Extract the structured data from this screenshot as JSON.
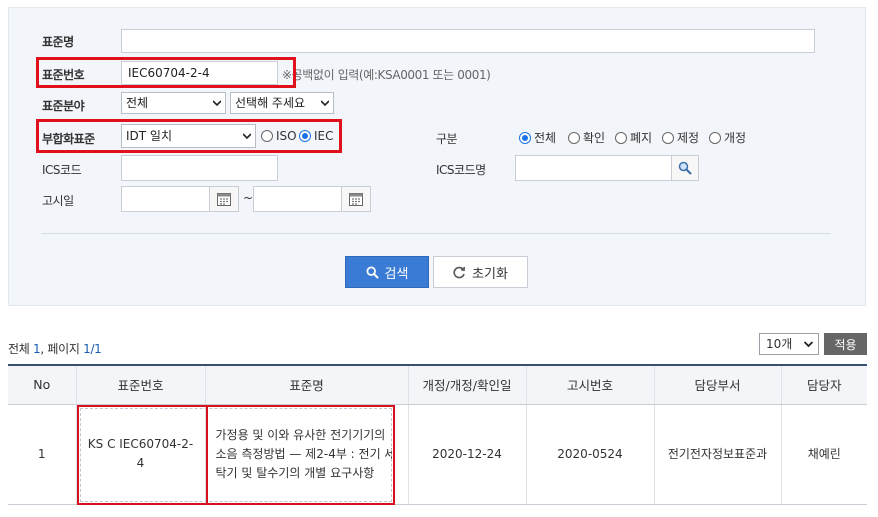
{
  "search": {
    "labels": {
      "name": "표준명",
      "number": "표준번호",
      "field": "표준분야",
      "conform": "부합화표준",
      "ics_code": "ICS코드",
      "notice_date": "고시일",
      "division": "구분",
      "ics_name": "ICS코드명"
    },
    "number_value": "IEC60704-2-4",
    "number_hint": "※공백없이 입력(예:KSA0001 또는 0001)",
    "field_select": "전체",
    "field_sub_select": "선택해 주세요",
    "conform_select": "IDT 일치",
    "conform_radios": [
      {
        "label": "ISO",
        "checked": false
      },
      {
        "label": "IEC",
        "checked": true
      }
    ],
    "division_radios": [
      {
        "label": "전체",
        "checked": true
      },
      {
        "label": "확인",
        "checked": false
      },
      {
        "label": "폐지",
        "checked": false
      },
      {
        "label": "제정",
        "checked": false
      },
      {
        "label": "개정",
        "checked": false
      }
    ],
    "date_sep": "~",
    "search_button": "검색",
    "reset_button": "초기화"
  },
  "results": {
    "total_label": "전체",
    "total_count": "1",
    "page_label": ", 페이지",
    "page_value": "1/1",
    "page_size": "10개",
    "apply_button": "적용",
    "columns": [
      "No",
      "표준번호",
      "표준명",
      "개정/개정/확인일",
      "고시번호",
      "담당부서",
      "담당자"
    ],
    "rows": [
      {
        "no": "1",
        "number": "KS C IEC60704-2-4",
        "title": "가정용 및 이와 유사한 전기기기의 소음 측정방법 — 제2-4부 : 전기 세탁기 및 탈수기의 개별 요구사항",
        "date": "2020-12-24",
        "notice": "2020-0524",
        "dept": "전기전자정보표준과",
        "manager": "채예린"
      }
    ]
  }
}
